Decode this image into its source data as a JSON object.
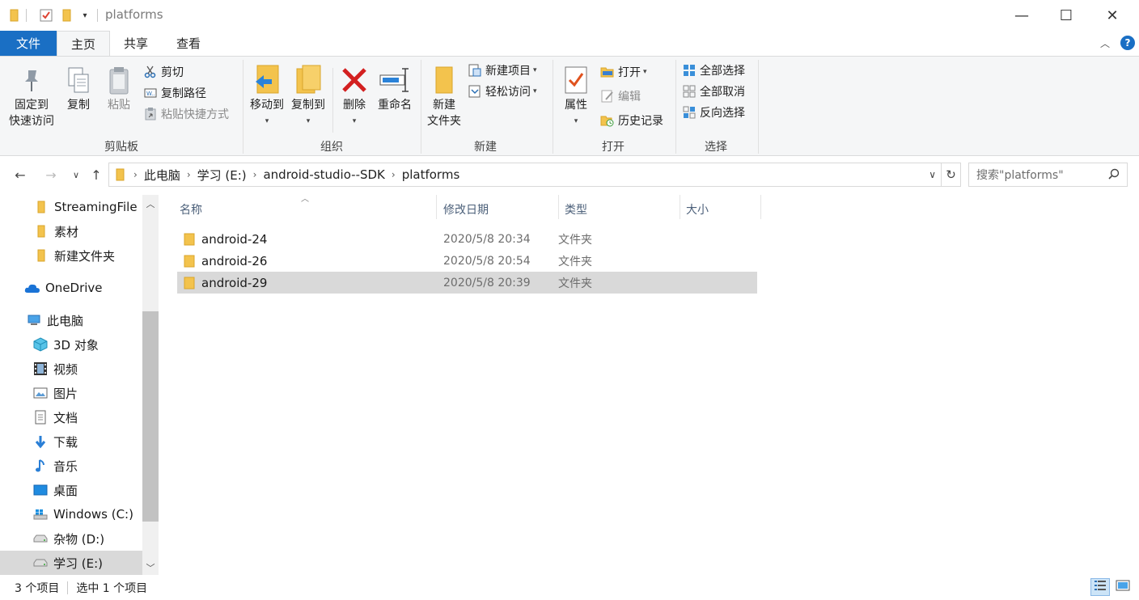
{
  "window": {
    "title": "platforms",
    "controls": {
      "minimize": "—",
      "maximize": "☐",
      "close": "✕"
    }
  },
  "ribbon_tabs": [
    "文件",
    "主页",
    "共享",
    "查看"
  ],
  "ribbon": {
    "clipboard": {
      "label": "剪贴板",
      "pin_line1": "固定到",
      "pin_line2": "快速访问",
      "copy": "复制",
      "paste": "粘贴",
      "cut": "剪切",
      "copy_path": "复制路径",
      "paste_shortcut": "粘贴快捷方式"
    },
    "organize": {
      "label": "组织",
      "move_to": "移动到",
      "copy_to": "复制到",
      "delete": "删除",
      "rename": "重命名"
    },
    "new": {
      "label": "新建",
      "new_folder_line1": "新建",
      "new_folder_line2": "文件夹",
      "new_item": "新建项目",
      "easy_access": "轻松访问"
    },
    "open": {
      "label": "打开",
      "properties": "属性",
      "open": "打开",
      "edit": "编辑",
      "history": "历史记录"
    },
    "select": {
      "label": "选择",
      "select_all": "全部选择",
      "select_none": "全部取消",
      "invert": "反向选择"
    }
  },
  "address": {
    "crumbs": [
      "此电脑",
      "学习 (E:)",
      "android-studio--SDK",
      "platforms"
    ],
    "search_placeholder": "搜索\"platforms\""
  },
  "nav_items": [
    {
      "label": "StreamingFile",
      "icon": "folder-icon"
    },
    {
      "label": "素材",
      "icon": "folder-icon"
    },
    {
      "label": "新建文件夹",
      "icon": "folder-icon"
    },
    {
      "label": "OneDrive",
      "icon": "onedrive-icon"
    },
    {
      "label": "此电脑",
      "icon": "this-pc-icon"
    },
    {
      "label": "3D 对象",
      "icon": "3d-objects-icon"
    },
    {
      "label": "视频",
      "icon": "videos-icon"
    },
    {
      "label": "图片",
      "icon": "pictures-icon"
    },
    {
      "label": "文档",
      "icon": "documents-icon"
    },
    {
      "label": "下载",
      "icon": "downloads-icon"
    },
    {
      "label": "音乐",
      "icon": "music-icon"
    },
    {
      "label": "桌面",
      "icon": "desktop-icon"
    },
    {
      "label": "Windows (C:)",
      "icon": "windows-drive-icon"
    },
    {
      "label": "杂物 (D:)",
      "icon": "drive-icon"
    },
    {
      "label": "学习 (E:)",
      "icon": "drive-icon",
      "selected": true
    }
  ],
  "columns": [
    "名称",
    "修改日期",
    "类型",
    "大小"
  ],
  "files": [
    {
      "name": "android-24",
      "date": "2020/5/8 20:34",
      "type": "文件夹",
      "size": ""
    },
    {
      "name": "android-26",
      "date": "2020/5/8 20:54",
      "type": "文件夹",
      "size": ""
    },
    {
      "name": "android-29",
      "date": "2020/5/8 20:39",
      "type": "文件夹",
      "size": "",
      "selected": true
    }
  ],
  "status": {
    "count": "3 个项目",
    "selection": "选中 1 个项目"
  },
  "colors": {
    "accent": "#1a6fc4",
    "folder": "#f3c34d",
    "selection": "#d9d9d9",
    "delete_red": "#d32020"
  }
}
